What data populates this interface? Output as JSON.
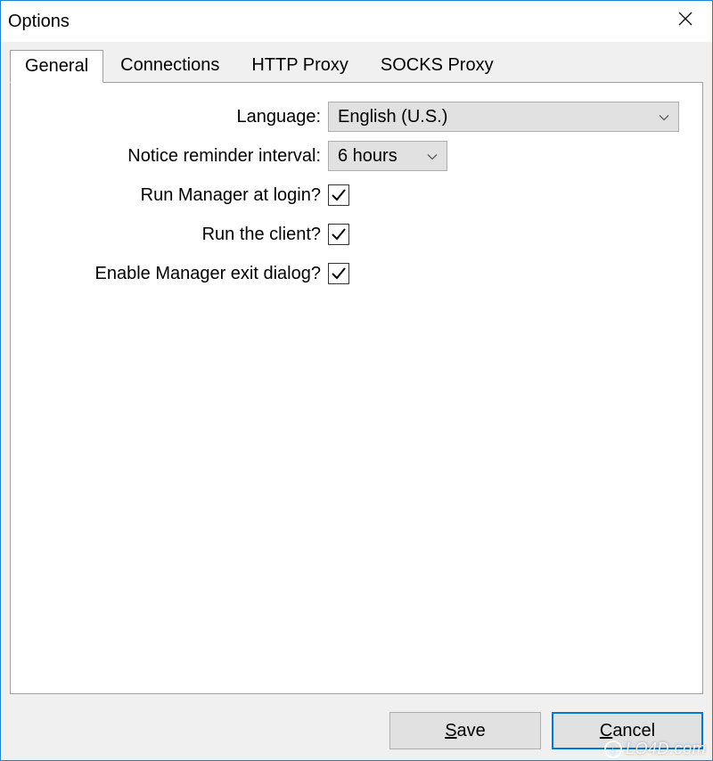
{
  "window": {
    "title": "Options"
  },
  "tabs": [
    {
      "label": "General",
      "active": true
    },
    {
      "label": "Connections",
      "active": false
    },
    {
      "label": "HTTP Proxy",
      "active": false
    },
    {
      "label": "SOCKS Proxy",
      "active": false
    }
  ],
  "general": {
    "language": {
      "label": "Language:",
      "value": "English (U.S.)"
    },
    "reminder": {
      "label": "Notice reminder interval:",
      "value": "6 hours"
    },
    "run_at_login": {
      "label": "Run Manager at login?",
      "checked": true
    },
    "run_client": {
      "label": "Run the client?",
      "checked": true
    },
    "exit_dialog": {
      "label": "Enable Manager exit dialog?",
      "checked": true
    }
  },
  "buttons": {
    "save": "Save",
    "cancel": "Cancel"
  },
  "watermark": "LO4D.com"
}
